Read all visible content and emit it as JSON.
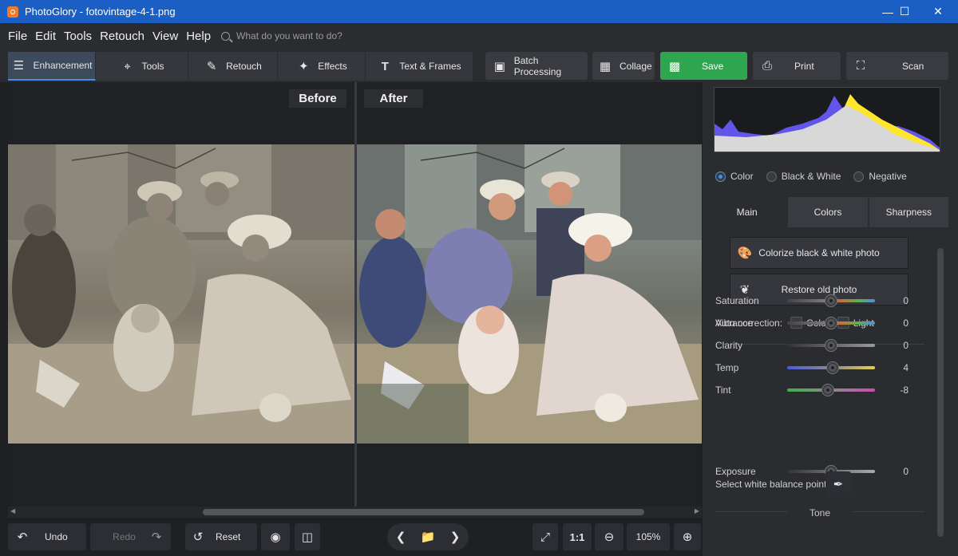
{
  "window": {
    "title": "PhotoGlory - fotovintage-4-1.png"
  },
  "menu": {
    "items": [
      "File",
      "Edit",
      "Tools",
      "Retouch",
      "View",
      "Help"
    ],
    "search_placeholder": "What do you want to do?"
  },
  "toolbar": {
    "tabs": [
      "Enhancement",
      "Tools",
      "Retouch",
      "Effects",
      "Text & Frames"
    ],
    "batch": "Batch Processing",
    "collage": "Collage",
    "save": "Save",
    "print": "Print",
    "scan": "Scan"
  },
  "canvas": {
    "before": "Before",
    "after": "After"
  },
  "bottom": {
    "undo": "Undo",
    "redo": "Redo",
    "reset": "Reset",
    "ratio": "1:1",
    "zoom": "105%"
  },
  "panel": {
    "modes": [
      "Color",
      "Black & White",
      "Negative"
    ],
    "tabs": [
      "Main",
      "Colors",
      "Sharpness"
    ],
    "colorize": "Colorize black & white photo",
    "restore": "Restore old photo",
    "auto_correction": "Auto correction:",
    "auto_color": "Color",
    "auto_light": "Light",
    "sliders": [
      {
        "label": "Saturation",
        "value": "0",
        "level": 0.5
      },
      {
        "label": "Vibrance",
        "value": "0",
        "level": 0.5
      },
      {
        "label": "Clarity",
        "value": "0",
        "level": 0.5
      },
      {
        "label": "Temp",
        "value": "4",
        "level": 0.52
      },
      {
        "label": "Tint",
        "value": "-8",
        "level": 0.46
      }
    ],
    "white_balance": "Select white balance point",
    "tone": "Tone",
    "exposure": {
      "label": "Exposure",
      "value": "0",
      "level": 0.5
    }
  }
}
